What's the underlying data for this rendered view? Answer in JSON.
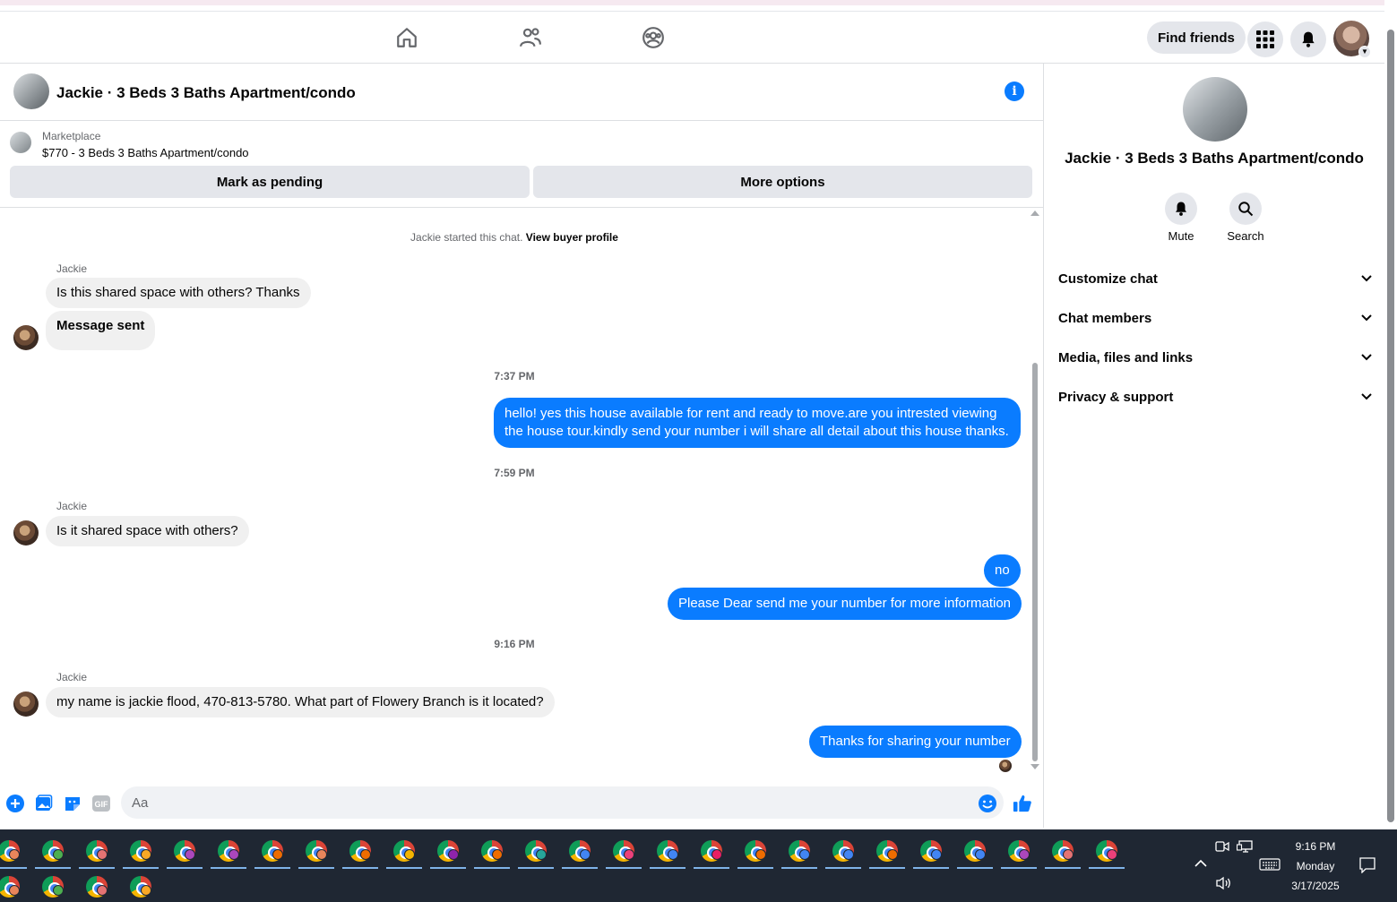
{
  "topnav": {
    "find_friends": "Find friends"
  },
  "chat": {
    "title": "Jackie · 3 Beds 3 Baths Apartment/condo",
    "marketplace_label": "Marketplace",
    "listing": "$770 - 3 Beds 3 Baths Apartment/condo",
    "mark_pending": "Mark as pending",
    "more_options": "More options",
    "started_text": "Jackie started this chat.",
    "view_buyer": "View buyer profile",
    "sender": "Jackie",
    "messages": {
      "m1": "Is this shared space with others? Thanks",
      "m2": "Message sent",
      "t1": "7:37 PM",
      "m3_line1": "hello! yes this house available for rent and ready to move.are you intrested viewing",
      "m3_line2": "the house tour.kindly send your number i will share all detail about this house thanks.",
      "t2": "7:59 PM",
      "m4": "Is it shared space with others?",
      "m5": "no",
      "m6": "Please Dear send me your number for more information",
      "t3": "9:16 PM",
      "m7": "my name is jackie flood, 470-813-5780.  What part of Flowery Branch is it located?",
      "m8": "Thanks for sharing your number"
    },
    "composer_placeholder": "Aa",
    "gif_label": "GIF"
  },
  "sidebar": {
    "title": "Jackie · 3 Beds 3 Baths Apartment/condo",
    "mute": "Mute",
    "search": "Search",
    "rows": [
      "Customize chat",
      "Chat members",
      "Media, files and links",
      "Privacy & support"
    ]
  },
  "taskbar": {
    "time": "9:16 PM",
    "day": "Monday",
    "date": "3/17/2025"
  },
  "colors": {
    "accent": "#0a7cff",
    "bubble_in": "#f0f0f0",
    "taskbar": "#1f2733"
  }
}
